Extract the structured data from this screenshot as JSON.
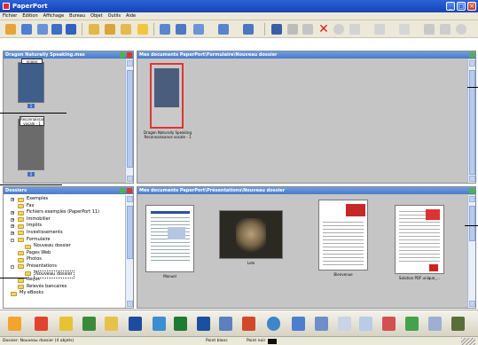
{
  "window": {
    "title": "PaperPort"
  },
  "menu": [
    "Fichier",
    "Edition",
    "Affichage",
    "Bureau",
    "Objet",
    "Outils",
    "Aide"
  ],
  "thumbnail_pane": {
    "title": "Dragon Naturally Speaking.max",
    "pages": [
      {
        "stamp": "nnaiss",
        "num": "1"
      },
      {
        "stamp": "Reconnaissance vocale - 1",
        "num": "2"
      }
    ]
  },
  "top_desktop": {
    "title": "Mes documents PaperPort\\Formulaire\\Nouveau dossier",
    "items": [
      {
        "caption_line1": "Dragon Naturally Speaking",
        "caption_line2": "Reconnaissance vocale - 1"
      }
    ]
  },
  "folders_pane": {
    "title": "Dossiers",
    "items": [
      {
        "label": "Exemples",
        "indent": 1,
        "expander": "+"
      },
      {
        "label": "Fax",
        "indent": 1,
        "expander": ""
      },
      {
        "label": "Fichiers exemples (PaperPort 11)",
        "indent": 1,
        "expander": "+"
      },
      {
        "label": "Immobilier",
        "indent": 1,
        "expander": "+"
      },
      {
        "label": "Impôts",
        "indent": 1,
        "expander": "+"
      },
      {
        "label": "Investissements",
        "indent": 1,
        "expander": "+"
      },
      {
        "label": "Formulaire",
        "indent": 1,
        "expander": "-"
      },
      {
        "label": "Nouveau dossier",
        "indent": 2,
        "expander": ""
      },
      {
        "label": "Pages Web",
        "indent": 1,
        "expander": ""
      },
      {
        "label": "Photos",
        "indent": 1,
        "expander": ""
      },
      {
        "label": "Présentations",
        "indent": 1,
        "expander": "-"
      },
      {
        "label": "Nouveau dossier",
        "indent": 2,
        "expander": "",
        "selected": true
      },
      {
        "label": "Reçus",
        "indent": 1,
        "expander": ""
      },
      {
        "label": "Relevés bancaires",
        "indent": 1,
        "expander": ""
      },
      {
        "label": "My eBooks",
        "indent": 0,
        "expander": ""
      }
    ]
  },
  "bottom_desktop": {
    "title": "Mes documents PaperPort\\Présentations\\Nouveau dossier",
    "items": [
      {
        "caption": "Manuel"
      },
      {
        "caption": "Lolo"
      },
      {
        "caption": "Bienvenue"
      },
      {
        "caption": "Solution PDF unique_..."
      }
    ]
  },
  "status": {
    "folder_text": "Dossier: Nouveau dossier (4 objets)",
    "point_blanc": "Point blanc",
    "point_noir": "Point noir"
  },
  "colors": {
    "title_blue": "#2d63d8",
    "pane_head": "#5a89d3",
    "pane_bg": "#c5c5c5"
  }
}
